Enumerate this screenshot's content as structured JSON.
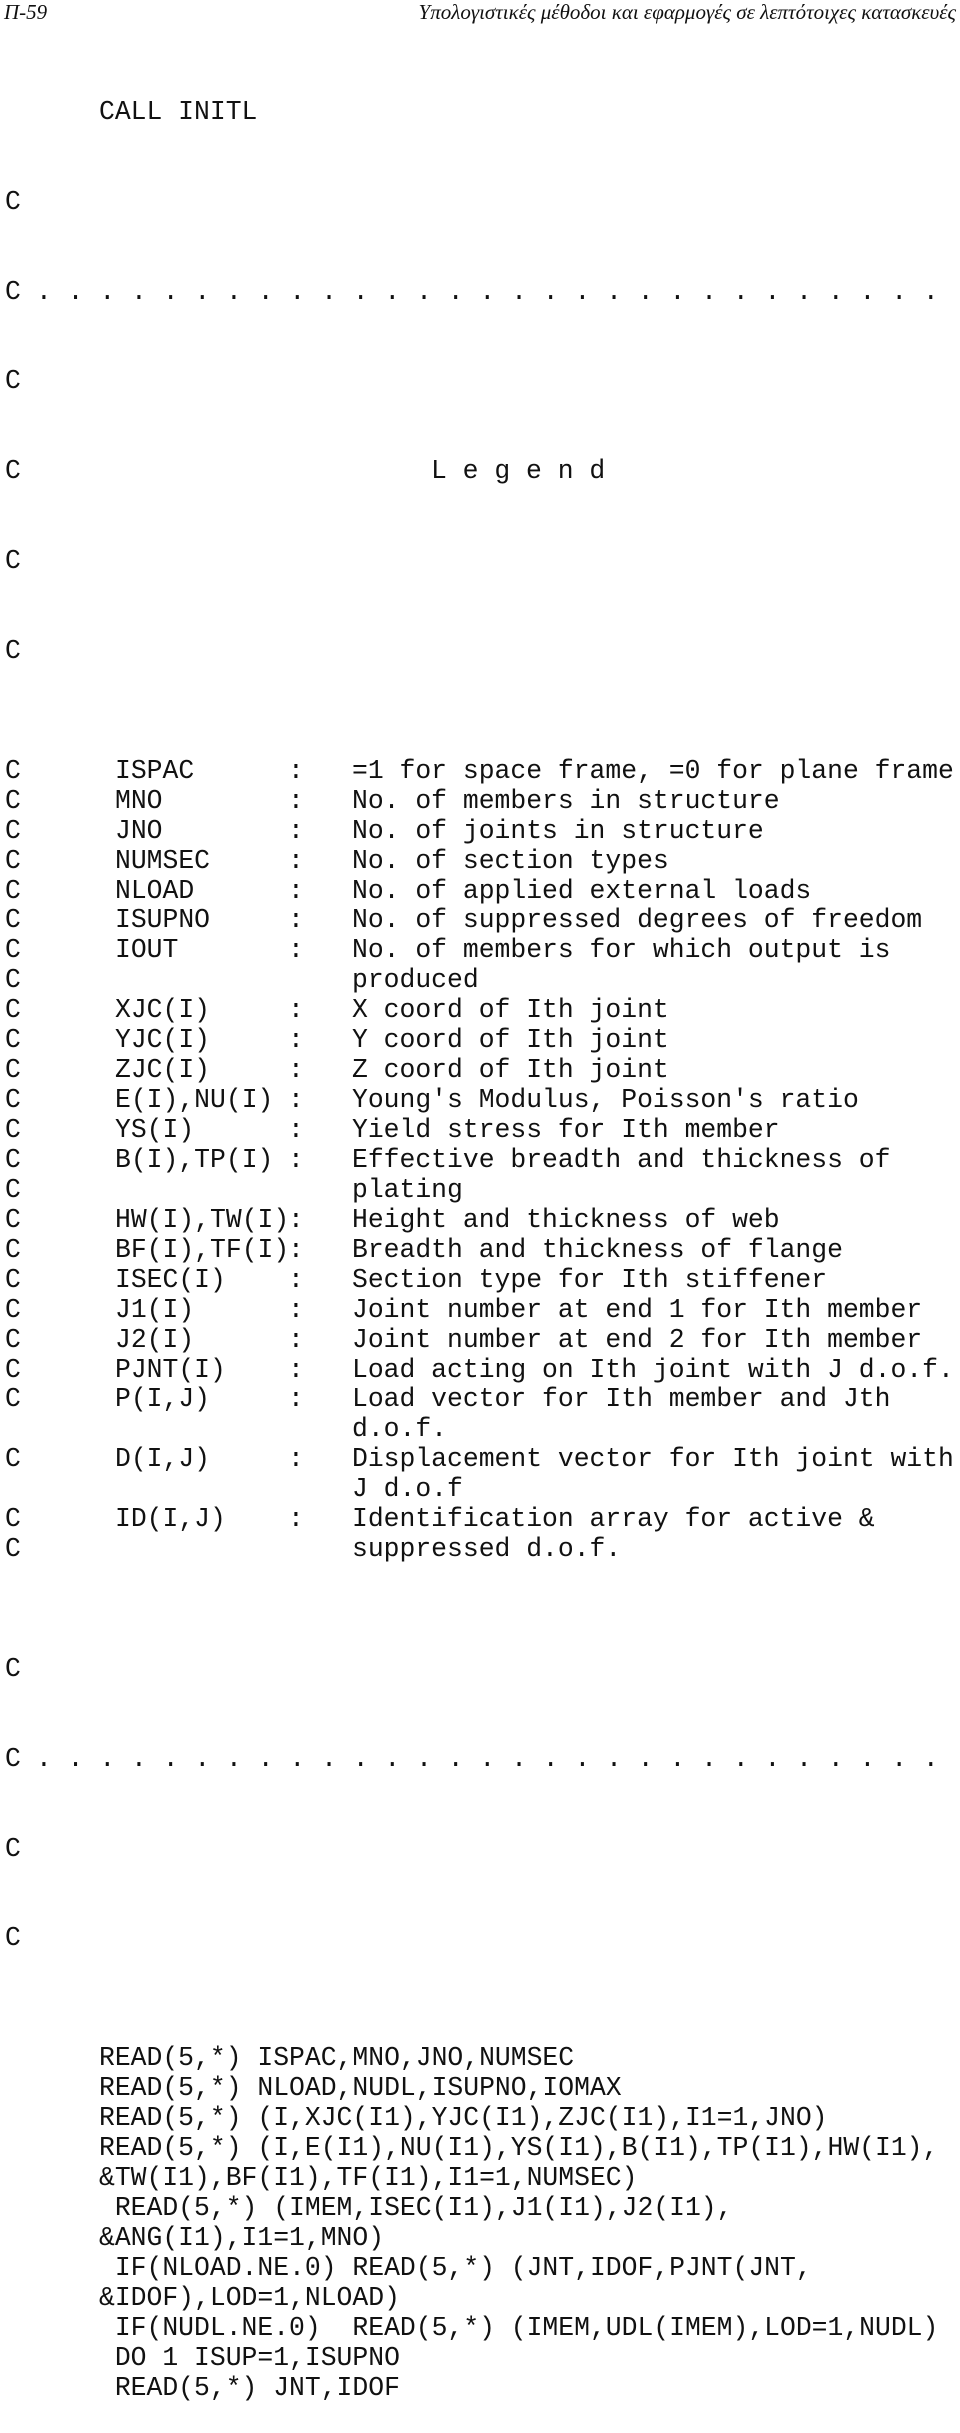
{
  "header": {
    "page_number": "Π-59",
    "title": "Υπολογιστικές μέθοδοι και εφαρμογές σε λεπτότοιχες κατασκευές"
  },
  "comment_char": "C",
  "dots": ". . . . . . . . . . . . . . . . . . . . . . . . . . . . .",
  "call_statement": "CALL INITL",
  "legend_title": "L e g e n d",
  "colon": ":",
  "legend": [
    {
      "var": "ISPAC",
      "desc": "=1 for space frame, =0 for plane frame"
    },
    {
      "var": "MNO",
      "desc": "No. of members in structure"
    },
    {
      "var": "JNO",
      "desc": "No. of joints in structure"
    },
    {
      "var": "NUMSEC",
      "desc": "No. of section types"
    },
    {
      "var": "NLOAD",
      "desc": "No. of applied external loads"
    },
    {
      "var": "ISUPNO",
      "desc": "No. of suppressed degrees of freedom"
    },
    {
      "var": "IOUT",
      "desc": "No. of members for which output is",
      "cont": "produced"
    },
    {
      "var": "XJC(I)",
      "desc": "X coord of Ith joint"
    },
    {
      "var": "YJC(I)",
      "desc": "Y coord of Ith joint"
    },
    {
      "var": "ZJC(I)",
      "desc": "Z coord of Ith joint"
    },
    {
      "var": "E(I),NU(I)",
      "desc": "Young's Modulus, Poisson's ratio"
    },
    {
      "var": "YS(I)",
      "desc": "Yield stress for Ith member"
    },
    {
      "var": "B(I),TP(I)",
      "desc": "Effective breadth and thickness of",
      "cont": "plating"
    },
    {
      "var": "HW(I),TW(I)",
      "desc": "Height and thickness of web"
    },
    {
      "var": "BF(I),TF(I)",
      "desc": "Breadth and thickness of flange"
    },
    {
      "var": "ISEC(I)",
      "desc": "Section type for Ith stiffener"
    },
    {
      "var": "J1(I)",
      "desc": "Joint number at end 1 for Ith member"
    },
    {
      "var": "J2(I)",
      "desc": "Joint number at end 2 for Ith member"
    },
    {
      "var": "PJNT(I)",
      "desc": "Load acting on Ith joint with J d.o.f."
    },
    {
      "var": "P(I,J)",
      "desc": "Load vector for Ith member and Jth",
      "cont": "d.o.f."
    },
    {
      "var": "D(I,J)",
      "desc": "Displacement vector for Ith joint with",
      "cont": "J d.o.f"
    },
    {
      "var": "ID(I,J)",
      "desc": "Identification array for active &",
      "cont": "suppressed d.o.f."
    }
  ],
  "statements": [
    "READ(5,*) ISPAC,MNO,JNO,NUMSEC",
    "READ(5,*) NLOAD,NUDL,ISUPNO,IOMAX",
    "READ(5,*) (I,XJC(I1),YJC(I1),ZJC(I1),I1=1,JNO)",
    "READ(5,*) (I,E(I1),NU(I1),YS(I1),B(I1),TP(I1),HW(I1),",
    "&TW(I1),BF(I1),TF(I1),I1=1,NUMSEC)",
    " READ(5,*) (IMEM,ISEC(I1),J1(I1),J2(I1),",
    "&ANG(I1),I1=1,MNO)",
    " IF(NLOAD.NE.0) READ(5,*) (JNT,IDOF,PJNT(JNT,",
    "&IDOF),LOD=1,NLOAD)",
    " IF(NUDL.NE.0)  READ(5,*) (IMEM,UDL(IMEM),LOD=1,NUDL)",
    " DO 1 ISUP=1,ISUPNO",
    " READ(5,*) JNT,IDOF"
  ]
}
